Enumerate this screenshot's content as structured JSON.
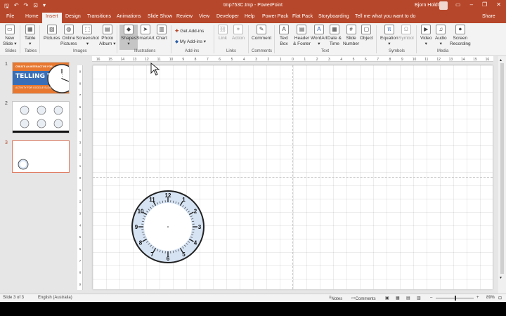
{
  "app": {
    "window_title": "tmp753C.tmp - PowerPoint",
    "user_name": "Bjorn Holdt",
    "tell_me": "Tell me what you want to do",
    "share": "Share",
    "qat": {
      "save": "🖫",
      "undo": "↶",
      "redo": "↷",
      "start": "⊡",
      "customize": "▾"
    },
    "window_buttons": {
      "ribbon_display": "▭",
      "minimize": "–",
      "restore": "❐",
      "close": "✕"
    }
  },
  "tabs": [
    "File",
    "Home",
    "Insert",
    "Design",
    "Transitions",
    "Animations",
    "Slide Show",
    "Review",
    "View",
    "Developer",
    "Help",
    "Power Pack",
    "Flat Pack",
    "Storyboarding"
  ],
  "active_tab": "Insert",
  "ribbon": {
    "new_slide": "New\nSlide ▾",
    "table": "Table\n▾",
    "pictures": "Pictures",
    "online_pictures": "Online\nPictures",
    "screenshot": "Screenshot\n▾",
    "photo_album": "Photo\nAlbum ▾",
    "shapes": "Shapes\n▾",
    "smartart": "SmartArt",
    "chart": "Chart",
    "get_addins": "Get Add-ins",
    "my_addins": "My Add-ins ▾",
    "link": "Link",
    "action": "Action",
    "comment": "Comment",
    "text_box": "Text\nBox",
    "header_footer": "Header\n& Footer",
    "wordart": "WordArt\n▾",
    "date_time": "Date &\nTime",
    "slide_number": "Slide\nNumber",
    "object": "Object",
    "equation": "Equation\n▾",
    "symbol": "Symbol",
    "video": "Video\n▾",
    "audio": "Audio\n▾",
    "screen_recording": "Screen\nRecording"
  },
  "groups": {
    "slides": "Slides",
    "tables": "Tables",
    "images": "Images",
    "illustrations": "Illustrations",
    "addins": "Add-ins",
    "links": "Links",
    "comments": "Comments",
    "text": "Text",
    "symbols": "Symbols",
    "media": "Media"
  },
  "icons": {
    "new_slide": "▭",
    "table": "▦",
    "pictures": "▨",
    "online_pictures": "◍",
    "screenshot": "⬚",
    "photo_album": "▤",
    "shapes": "◆",
    "smartart": "➤",
    "chart": "▥",
    "link": "⛓",
    "action": "✶",
    "comment": "✎",
    "text_box": "A",
    "header_footer": "▤",
    "wordart": "A",
    "date_time": "▦",
    "slide_number": "#",
    "object": "▢",
    "equation": "π",
    "symbol": "Ω",
    "video": "▶",
    "audio": "♫",
    "screen_recording": "⏺",
    "get_addins": "✚",
    "my_addins": "◆"
  },
  "ruler": {
    "h_ticks": [
      "16",
      "15",
      "14",
      "13",
      "12",
      "11",
      "10",
      "9",
      "8",
      "7",
      "6",
      "5",
      "4",
      "3",
      "2",
      "1",
      "0",
      "1",
      "2",
      "3",
      "4",
      "5",
      "6",
      "7",
      "8",
      "9",
      "10",
      "11",
      "12",
      "13",
      "14",
      "15",
      "16"
    ],
    "v_ticks": [
      "9",
      "8",
      "7",
      "6",
      "5",
      "4",
      "3",
      "2",
      "1",
      "0",
      "1",
      "2",
      "3",
      "4",
      "5",
      "6",
      "7",
      "8",
      "9"
    ]
  },
  "slides": [
    {
      "number": "1",
      "title_small": "CREATE AN INTERACTIVE FOR",
      "title": "TELLING TIME",
      "subtitle": "ACTIVITY FOR GOOGLE SLIDES",
      "accent": "#e8782f",
      "banner": "#3a6fb7"
    },
    {
      "number": "2"
    },
    {
      "number": "3"
    }
  ],
  "clock_numbers": [
    "12",
    "1",
    "2",
    "3",
    "4",
    "5",
    "6",
    "7",
    "8",
    "9",
    "10",
    "11"
  ],
  "status": {
    "slide_info": "Slide 3 of 3",
    "language": "English (Australia)",
    "notes": "Notes",
    "comments": "Comments",
    "zoom": "89%",
    "zoom_minus": "–",
    "zoom_plus": "+"
  },
  "colors": {
    "accent": "#b7472a",
    "clock_face": "#d6e3f3"
  }
}
